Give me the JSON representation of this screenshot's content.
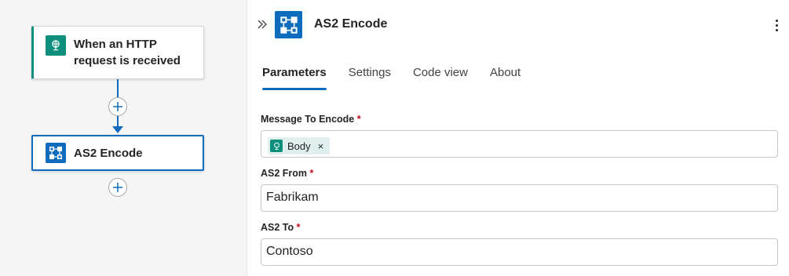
{
  "canvas": {
    "trigger": {
      "label_line1": "When an HTTP",
      "label_line2": "request is received",
      "icon": "http-request-icon"
    },
    "action": {
      "label": "AS2 Encode",
      "icon": "as2-icon"
    },
    "add_button_icon": "plus-icon"
  },
  "panel": {
    "title": "AS2 Encode",
    "tabs": [
      {
        "label": "Parameters",
        "active": true
      },
      {
        "label": "Settings",
        "active": false
      },
      {
        "label": "Code view",
        "active": false
      },
      {
        "label": "About",
        "active": false
      }
    ],
    "fields": {
      "message": {
        "label": "Message To Encode",
        "required_mark": "*",
        "token_label": "Body",
        "token_close": "×"
      },
      "from": {
        "label": "AS2 From",
        "required_mark": "*",
        "value": "Fabrikam"
      },
      "to": {
        "label": "AS2 To",
        "required_mark": "*",
        "value": "Contoso"
      }
    }
  },
  "colors": {
    "accent": "#0f6cbd",
    "trigger": "#0e8f7e",
    "required": "#c50f1f",
    "token_bg": "#e1f0ee"
  }
}
